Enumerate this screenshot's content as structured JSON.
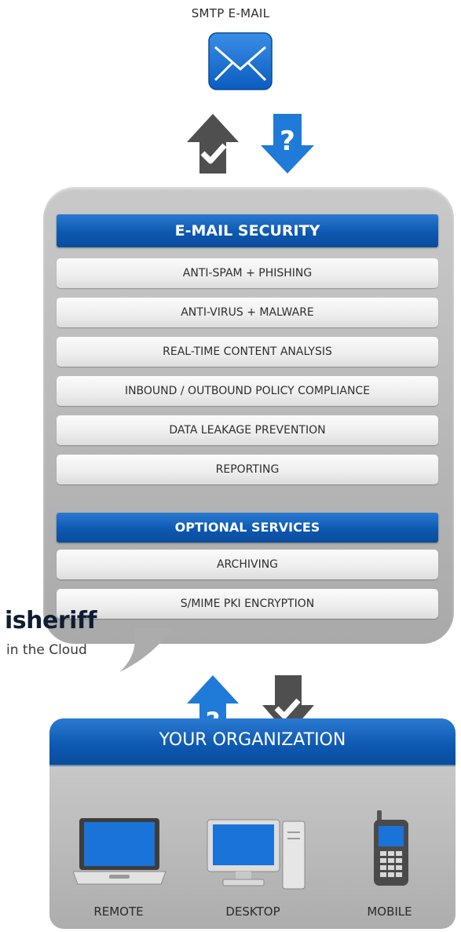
{
  "top": {
    "label": "SMTP E-MAIL",
    "icon": "envelope-icon"
  },
  "email_security": {
    "title": "E-MAIL SECURITY",
    "items": [
      "ANTI-SPAM + PHISHING",
      "ANTI-VIRUS + MALWARE",
      "REAL-TIME CONTENT ANALYSIS",
      "INBOUND / OUTBOUND POLICY COMPLIANCE",
      "DATA LEAKAGE PREVENTION",
      "REPORTING"
    ]
  },
  "optional_services": {
    "title": "OPTIONAL SERVICES",
    "items": [
      "ARCHIVING",
      "S/MIME PKI ENCRYPTION"
    ]
  },
  "logo": {
    "name": "isheriff",
    "tagline": "in the Cloud"
  },
  "organization": {
    "title": "YOUR ORGANIZATION",
    "devices": [
      {
        "label": "REMOTE",
        "icon": "laptop-icon"
      },
      {
        "label": "DESKTOP",
        "icon": "desktop-computer-icon"
      },
      {
        "label": "MOBILE",
        "icon": "mobile-phone-icon"
      }
    ]
  },
  "colors": {
    "blue": "#0d58b1",
    "dark_gray": "#4d4d4d",
    "panel_gray": "#b8b8b8"
  }
}
